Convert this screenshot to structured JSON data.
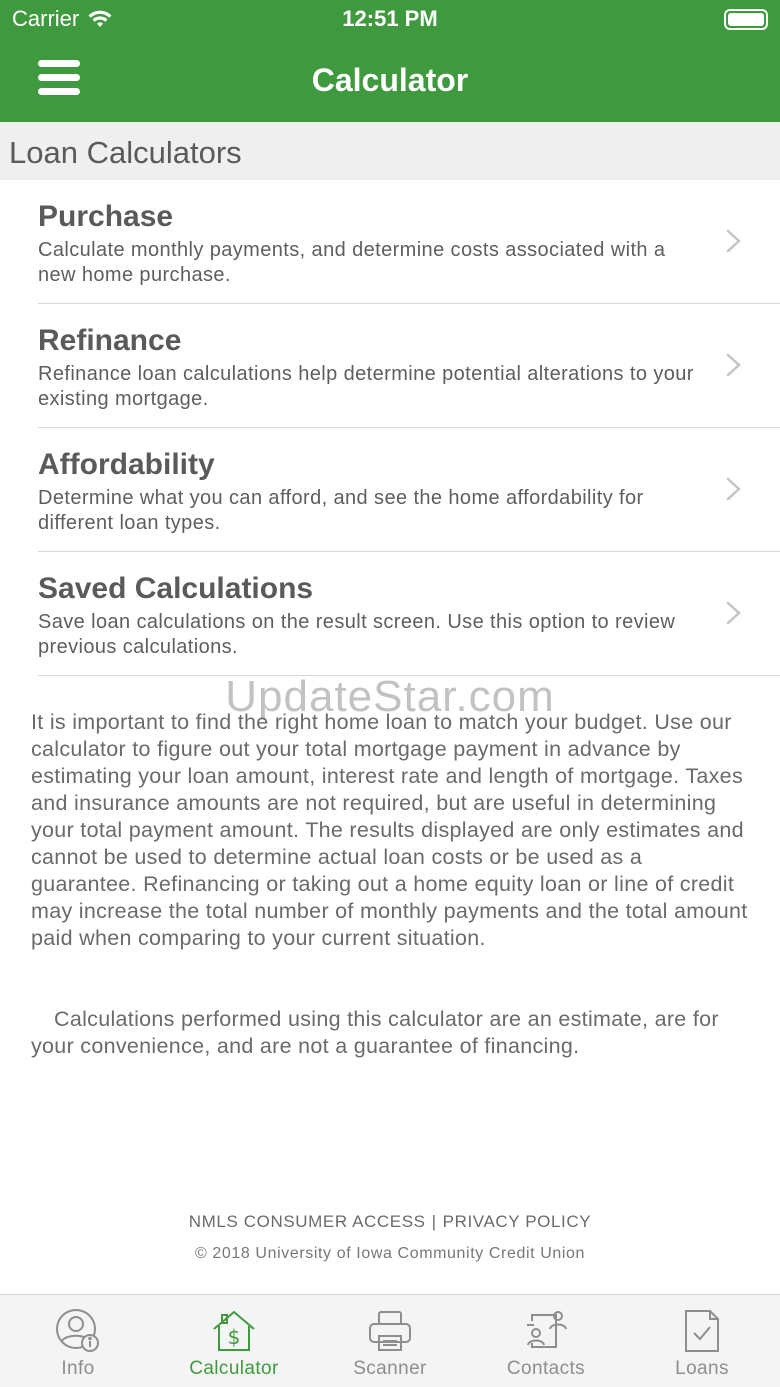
{
  "status_bar": {
    "carrier": "Carrier",
    "time": "12:51 PM"
  },
  "nav": {
    "title": "Calculator"
  },
  "section": {
    "title": "Loan Calculators"
  },
  "menu": [
    {
      "title": "Purchase",
      "description": "Calculate monthly payments, and determine costs associated with a new home purchase."
    },
    {
      "title": "Refinance",
      "description": "Refinance loan calculations help determine potential alterations to your existing mortgage."
    },
    {
      "title": "Affordability",
      "description": "Determine what you can afford, and see the home affordability for different loan types."
    },
    {
      "title": "Saved Calculations",
      "description": "Save loan calculations on the result screen. Use this option to review previous calculations."
    }
  ],
  "watermark": "UpdateStar.com",
  "info_text": "It is important to find the right home loan to match your budget. Use our calculator to figure out your total mortgage payment in advance by estimating your loan amount, interest rate and length of mortgage. Taxes and insurance amounts are not required, but are useful in determining your total payment amount. The results displayed are only estimates and cannot be used to determine actual loan costs or be used as a guarantee. Refinancing or taking out a home equity loan or line of credit may increase the total number of monthly payments and the total amount paid when comparing to your current situation.",
  "disclaimer": "Calculations performed using this calculator are an estimate, are for your convenience, and are not a guarantee of financing.",
  "footer": {
    "nmls_link": "NMLS CONSUMER ACCESS",
    "separator": "|",
    "privacy_link": "PRIVACY POLICY",
    "copyright": "© 2018 University of Iowa Community Credit Union"
  },
  "tabs": [
    {
      "label": "Info",
      "icon": "info-person-icon",
      "active": false
    },
    {
      "label": "Calculator",
      "icon": "house-dollar-icon",
      "active": true
    },
    {
      "label": "Scanner",
      "icon": "printer-icon",
      "active": false
    },
    {
      "label": "Contacts",
      "icon": "contacts-icon",
      "active": false
    },
    {
      "label": "Loans",
      "icon": "document-check-icon",
      "active": false
    }
  ],
  "colors": {
    "brand_green": "#3f9a3f",
    "section_bg": "#efefef",
    "tab_bar_bg": "#f4f4f4"
  }
}
